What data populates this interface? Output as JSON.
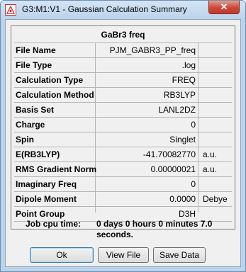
{
  "window": {
    "title": "G3:M1:V1 - Gaussian Calculation Summary",
    "close_symbol": "✕"
  },
  "panel": {
    "title": "GaBr3 freq",
    "rows": [
      {
        "label": "File Name",
        "value": "PJM_GABR3_PP_freq",
        "unit": ""
      },
      {
        "label": "File Type",
        "value": ".log",
        "unit": ""
      },
      {
        "label": "Calculation Type",
        "value": "FREQ",
        "unit": ""
      },
      {
        "label": "Calculation Method",
        "value": "RB3LYP",
        "unit": ""
      },
      {
        "label": "Basis Set",
        "value": "LANL2DZ",
        "unit": ""
      },
      {
        "label": "Charge",
        "value": "0",
        "unit": ""
      },
      {
        "label": "Spin",
        "value": "Singlet",
        "unit": ""
      },
      {
        "label": "E(RB3LYP)",
        "value": "-41.70082770",
        "unit": "a.u."
      },
      {
        "label": "RMS Gradient Norm",
        "value": "0.00000021",
        "unit": "a.u."
      },
      {
        "label": "Imaginary Freq",
        "value": "0",
        "unit": ""
      },
      {
        "label": "Dipole Moment",
        "value": "0.0000",
        "unit": "Debye"
      },
      {
        "label": "Point Group",
        "value": "D3H",
        "unit": ""
      }
    ],
    "cpu_label": "Job cpu time:",
    "cpu_value": "0 days  0 hours  0 minutes  7.0 seconds."
  },
  "buttons": {
    "ok": "Ok",
    "view_file": "View File",
    "save_data": "Save Data"
  }
}
